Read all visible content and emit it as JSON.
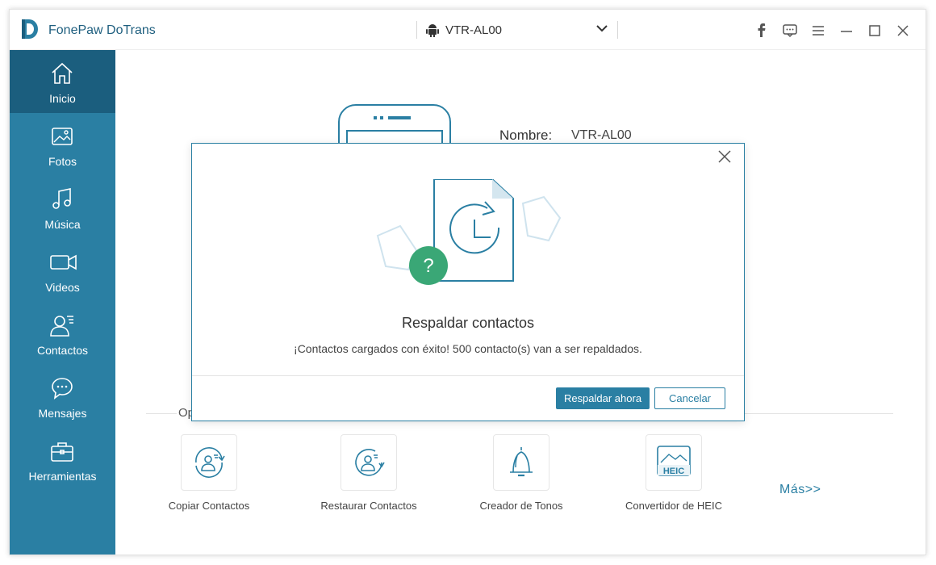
{
  "app": {
    "title": "FonePaw DoTrans"
  },
  "device": {
    "name": "VTR-AL00"
  },
  "sidebar": {
    "items": [
      {
        "label": "Inicio",
        "icon": "home-icon",
        "active": true
      },
      {
        "label": "Fotos",
        "icon": "photo-icon",
        "active": false
      },
      {
        "label": "Música",
        "icon": "music-icon",
        "active": false
      },
      {
        "label": "Videos",
        "icon": "video-icon",
        "active": false
      },
      {
        "label": "Contactos",
        "icon": "contacts-icon",
        "active": false
      },
      {
        "label": "Mensajes",
        "icon": "message-icon",
        "active": false
      },
      {
        "label": "Herramientas",
        "icon": "toolbox-icon",
        "active": false
      }
    ]
  },
  "main": {
    "info_label": "Nombre:",
    "info_value": "VTR-AL00",
    "options_label": "Op",
    "tools": [
      {
        "label": "Copiar Contactos",
        "icon": "copy-contacts-icon"
      },
      {
        "label": "Restaurar Contactos",
        "icon": "restore-contacts-icon"
      },
      {
        "label": "Creador de Tonos",
        "icon": "bell-icon"
      },
      {
        "label": "Convertidor de HEIC",
        "icon": "heic-icon"
      }
    ],
    "more_label": "Más>>",
    "heic_badge": "HEIC"
  },
  "dialog": {
    "title": "Respaldar contactos",
    "message": "¡Contactos cargados con éxito! 500 contacto(s) van a ser repaldados.",
    "primary_button": "Respaldar ahora",
    "secondary_button": "Cancelar",
    "badge_symbol": "?"
  },
  "colors": {
    "accent": "#2a7fa3",
    "sidebar_active": "#1b5e7e",
    "badge_green": "#3aa776"
  }
}
